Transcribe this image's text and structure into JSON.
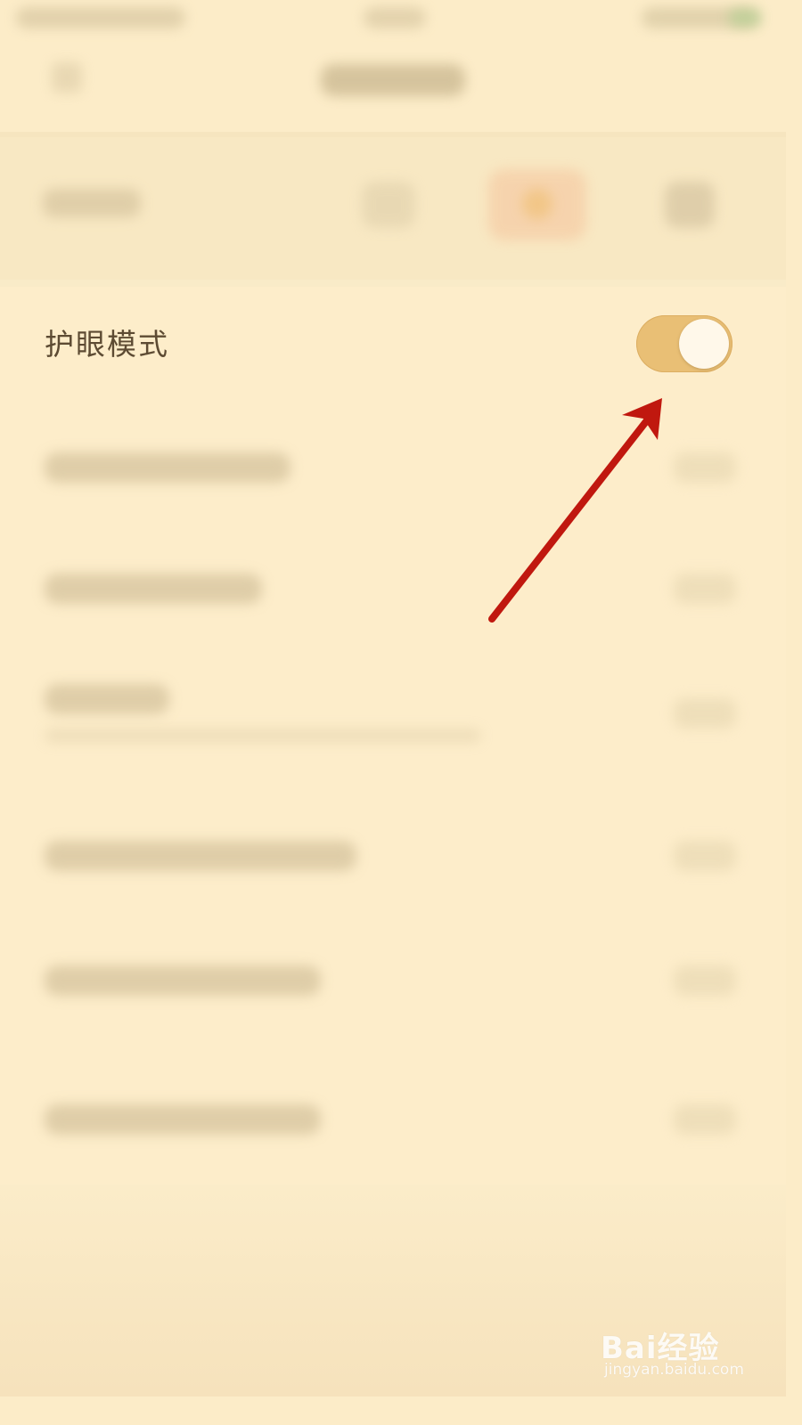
{
  "eye_protection": {
    "label": "护眼模式",
    "enabled": true,
    "toggle_color": "#e9bf75"
  },
  "annotation": {
    "type": "arrow",
    "color": "#c0180f",
    "points_to": "eye-protection-toggle"
  },
  "watermark": {
    "brand": "Bai经验",
    "url": "jingyan.baidu.com"
  },
  "colors": {
    "background": "#fcecc8",
    "text": "#5d4b33"
  }
}
